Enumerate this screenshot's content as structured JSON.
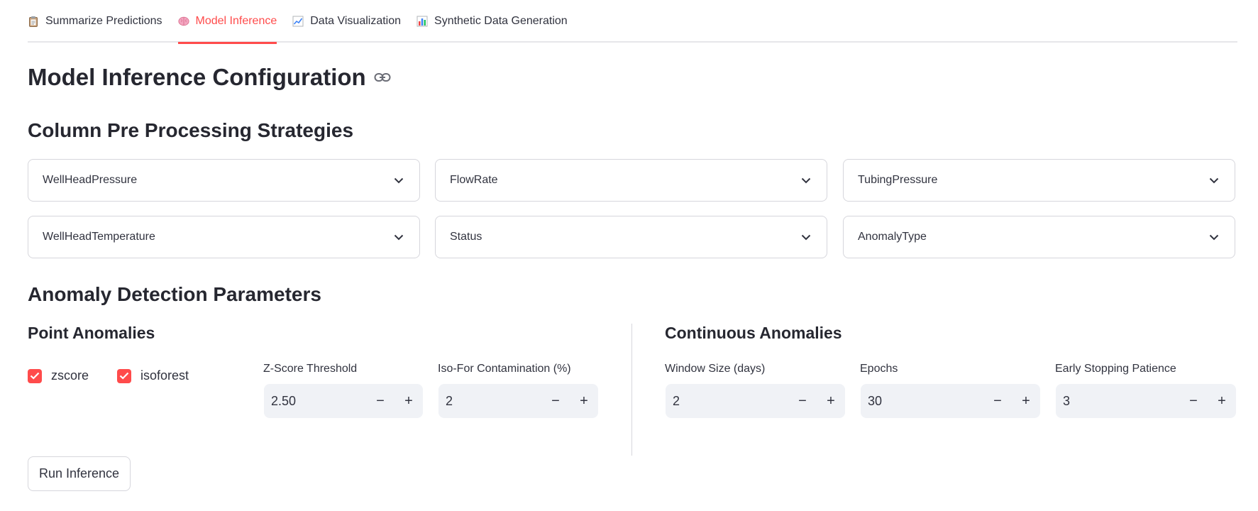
{
  "tabs": [
    {
      "label": "Summarize Predictions",
      "icon": "clipboard-icon",
      "active": false
    },
    {
      "label": "Model Inference",
      "icon": "brain-icon",
      "active": true
    },
    {
      "label": "Data Visualization",
      "icon": "line-chart-icon",
      "active": false
    },
    {
      "label": "Synthetic Data Generation",
      "icon": "bar-chart-icon",
      "active": false
    }
  ],
  "page_title": "Model Inference Configuration",
  "preprocessing": {
    "title": "Column Pre Processing Strategies",
    "columns": [
      "WellHeadPressure",
      "FlowRate",
      "TubingPressure",
      "WellHeadTemperature",
      "Status",
      "AnomalyType"
    ]
  },
  "anomaly": {
    "title": "Anomaly Detection Parameters",
    "point": {
      "title": "Point Anomalies",
      "methods": [
        {
          "label": "zscore",
          "checked": true
        },
        {
          "label": "isoforest",
          "checked": true
        }
      ],
      "zscore_threshold": {
        "label": "Z-Score Threshold",
        "value": "2.50"
      },
      "isofor_contamination": {
        "label": "Iso-For Contamination (%)",
        "value": "2"
      }
    },
    "continuous": {
      "title": "Continuous Anomalies",
      "window_size": {
        "label": "Window Size (days)",
        "value": "2"
      },
      "epochs": {
        "label": "Epochs",
        "value": "30"
      },
      "patience": {
        "label": "Early Stopping Patience",
        "value": "3"
      }
    }
  },
  "stepper": {
    "minus": "−",
    "plus": "+"
  },
  "run_button": "Run Inference",
  "colors": {
    "accent": "#ff4b4b",
    "input_bg": "#f0f2f6",
    "text": "#31333f"
  }
}
